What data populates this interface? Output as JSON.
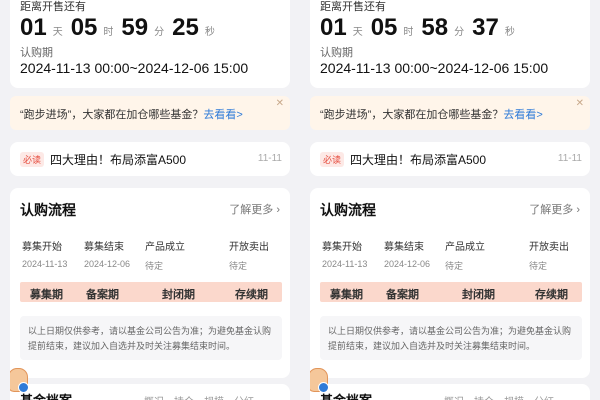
{
  "countdown": {
    "title": "距离开售还有",
    "label": "认购期",
    "date_range": "2024-11-13 00:00~2024-12-06 15:00"
  },
  "panels": [
    {
      "days": "01",
      "hours": "05",
      "minutes": "59",
      "seconds": "25"
    },
    {
      "days": "01",
      "hours": "05",
      "minutes": "58",
      "seconds": "37"
    }
  ],
  "units": {
    "day": "天",
    "hour": "时",
    "minute": "分",
    "second": "秒"
  },
  "banner": {
    "text": "“跑步进场”，大家都在加仓哪些基金？",
    "link": "去看看>",
    "close": "✕"
  },
  "news": {
    "badge": "必读",
    "title": "四大理由！布局添富A500",
    "date": "11-11"
  },
  "process": {
    "title": "认购流程",
    "more": "了解更多 ›",
    "steps": [
      {
        "label": "募集开始",
        "value": "2024-11-13"
      },
      {
        "label": "募集结束",
        "value": "2024-12-06"
      },
      {
        "label": "产品成立",
        "value": "待定"
      },
      {
        "label": "开放卖出",
        "value": "待定"
      }
    ],
    "phases": [
      "募集期",
      "备案期",
      "封闭期",
      "存续期"
    ],
    "note": "以上日期仅供参考，请以基金公司公告为准；为避免基金认购提前结束，建议加入自选并及时关注募集结束时间。"
  },
  "archive": {
    "title": "基金档案",
    "tabs": [
      "概况",
      "持仓",
      "规模",
      "分红"
    ]
  },
  "colors": {
    "accent_link": "#2f7bd8",
    "badge_red": "#e64a3c",
    "phase_bg": "#fbd8cc",
    "banner_bg": "#fff5ea"
  },
  "icons": {
    "avatar": "mascot-avatar-icon"
  }
}
